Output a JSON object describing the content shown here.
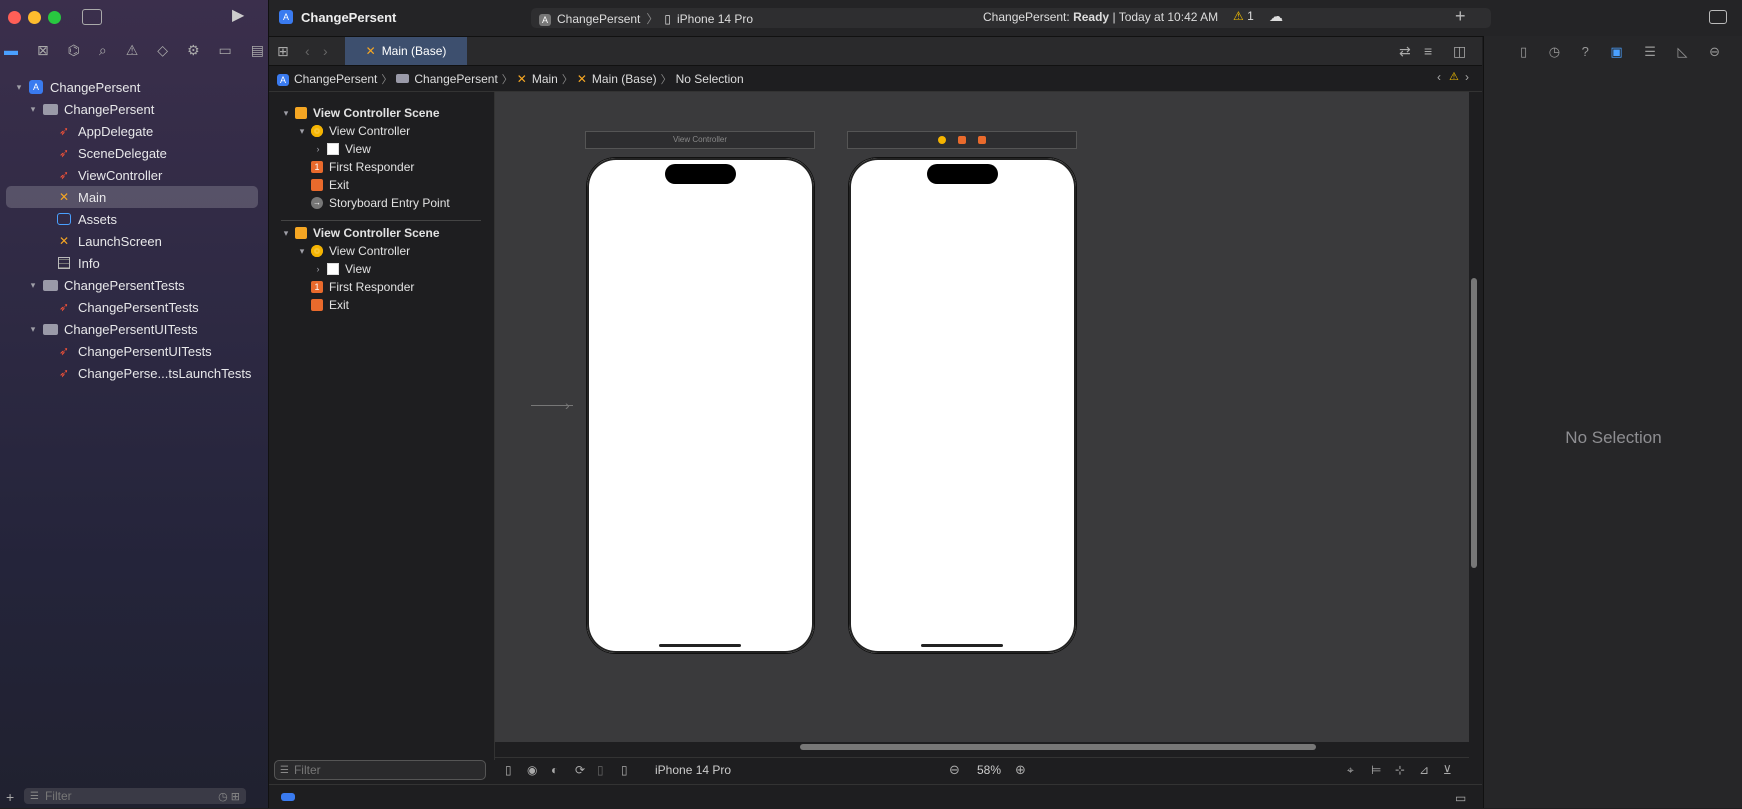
{
  "window": {
    "project_name": "ChangePersent",
    "scheme": "ChangePersent",
    "destination": "iPhone 14 Pro",
    "status_prefix": "ChangePersent:",
    "status_state": "Ready",
    "status_time": "| Today at 10:42 AM",
    "warning_count": "1"
  },
  "navigator": {
    "tree": [
      {
        "label": "ChangePersent",
        "kind": "project",
        "level": 0
      },
      {
        "label": "ChangePersent",
        "kind": "folder",
        "level": 1
      },
      {
        "label": "AppDelegate",
        "kind": "swift",
        "level": 2
      },
      {
        "label": "SceneDelegate",
        "kind": "swift",
        "level": 2
      },
      {
        "label": "ViewController",
        "kind": "swift",
        "level": 2
      },
      {
        "label": "Main",
        "kind": "storyboard",
        "level": 2,
        "selected": true
      },
      {
        "label": "Assets",
        "kind": "assets",
        "level": 2
      },
      {
        "label": "LaunchScreen",
        "kind": "storyboard",
        "level": 2
      },
      {
        "label": "Info",
        "kind": "plist",
        "level": 2
      },
      {
        "label": "ChangePersentTests",
        "kind": "folder",
        "level": 1
      },
      {
        "label": "ChangePersentTests",
        "kind": "swift",
        "level": 2
      },
      {
        "label": "ChangePersentUITests",
        "kind": "folder",
        "level": 1
      },
      {
        "label": "ChangePersentUITests",
        "kind": "swift",
        "level": 2
      },
      {
        "label": "ChangePerse...tsLaunchTests",
        "kind": "swift",
        "level": 2
      }
    ],
    "filter_placeholder": "Filter"
  },
  "editor": {
    "tab_label": "Main (Base)",
    "breadcrumb": [
      "ChangePersent",
      "ChangePersent",
      "Main",
      "Main (Base)",
      "No Selection"
    ],
    "outline": {
      "scene1_title": "View Controller Scene",
      "scene1_vc": "View Controller",
      "scene1_view": "View",
      "scene1_fr": "First Responder",
      "scene1_exit": "Exit",
      "scene1_entry": "Storyboard Entry Point",
      "scene2_title": "View Controller Scene",
      "scene2_vc": "View Controller",
      "scene2_view": "View",
      "scene2_fr": "First Responder",
      "scene2_exit": "Exit",
      "filter_placeholder": "Filter"
    },
    "canvas": {
      "scene1_label": "View Controller"
    },
    "bottom": {
      "device": "iPhone 14 Pro",
      "zoom": "58%"
    }
  },
  "inspector": {
    "empty_text": "No Selection"
  },
  "colors": {
    "accent": "#3a7bf0",
    "swift": "#f05138",
    "storyboard": "#f5a623"
  }
}
